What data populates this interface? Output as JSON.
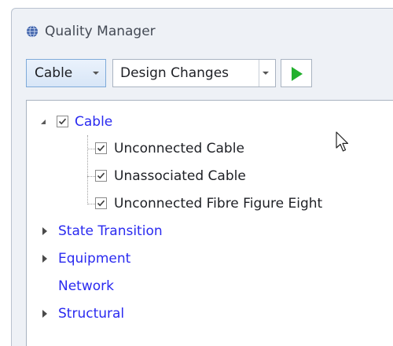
{
  "window": {
    "title": "Quality Manager",
    "app_icon": "globe-icon"
  },
  "toolbar": {
    "category_select": {
      "value": "Cable"
    },
    "rule_set_select": {
      "value": "Design Changes"
    },
    "run_icon": "play-icon",
    "run_color": "#22b02e"
  },
  "tree": {
    "link_color": "#2a2af0",
    "nodes": [
      {
        "label": "Cable",
        "expanded": true,
        "checked": true,
        "children": [
          {
            "label": "Unconnected Cable",
            "checked": true
          },
          {
            "label": "Unassociated Cable",
            "checked": true
          },
          {
            "label": "Unconnected Fibre Figure Eight",
            "checked": true
          }
        ]
      },
      {
        "label": "State Transition",
        "expanded": false
      },
      {
        "label": "Equipment",
        "expanded": false
      },
      {
        "label": "Network",
        "expanded": false,
        "has_children": false
      },
      {
        "label": "Structural",
        "expanded": false
      }
    ]
  }
}
